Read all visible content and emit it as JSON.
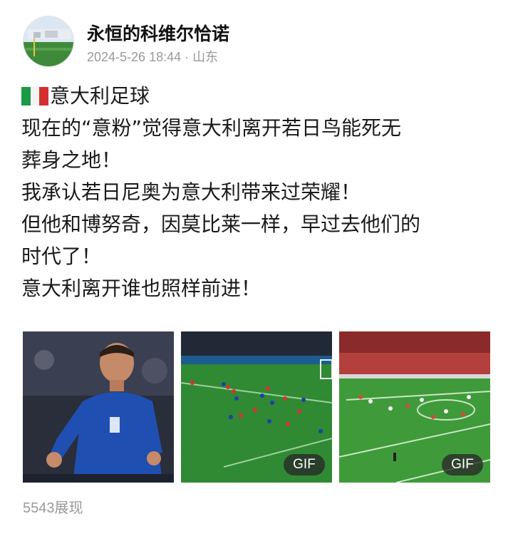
{
  "author": {
    "name": "永恒的科维尔恰诺",
    "timestamp": "2024-5-26 18:44",
    "separator": "·",
    "location": "山东"
  },
  "post": {
    "flag_icon": "italy-flag-icon",
    "topic": "意大利足球",
    "lines": [
      "现在的“意粉”觉得意大利离开若日鸟能死无",
      "葬身之地！",
      "我承认若日尼奥为意大利带来过荣耀！",
      "但他和博努奇，因莫比莱一样，早过去他们的",
      "时代了！",
      "意大利离开谁也照样前进！"
    ]
  },
  "media": [
    {
      "kind": "image",
      "badge": ""
    },
    {
      "kind": "gif",
      "badge": "GIF"
    },
    {
      "kind": "gif",
      "badge": "GIF"
    }
  ],
  "stats": {
    "views": "5543展现"
  },
  "colors": {
    "text": "#1a1a1a",
    "meta": "#9a9a9a",
    "pitch": "#2e7d32"
  }
}
